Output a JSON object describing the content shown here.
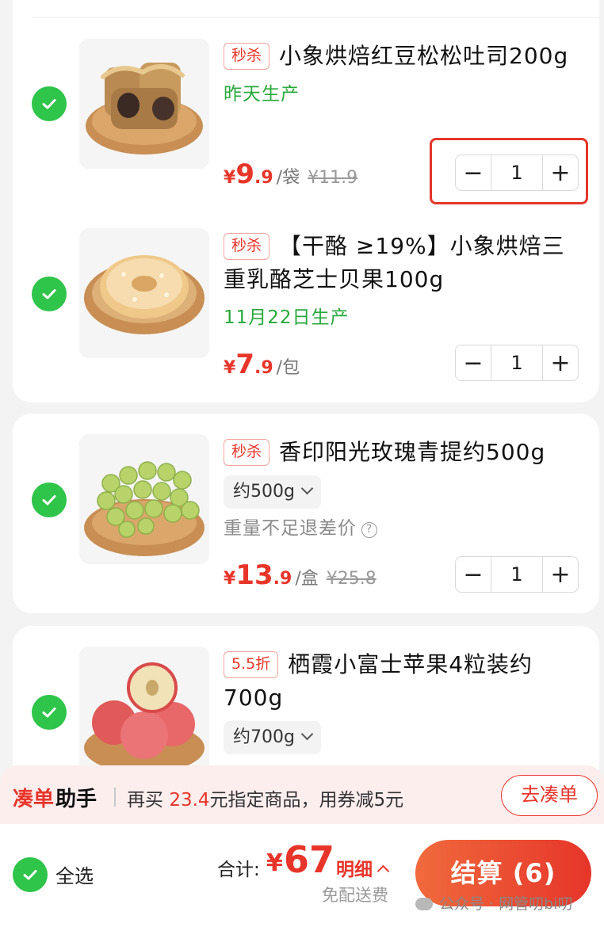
{
  "items": [
    {
      "tag": "秒杀",
      "title": "小象烘焙红豆松松吐司200g",
      "date": "昨天生产",
      "currency": "¥",
      "price_int": "9",
      "price_dec": ".9",
      "unit": "/袋",
      "old_price": "¥11.9",
      "qty": "1"
    },
    {
      "tag": "秒杀",
      "title": "【干酪 ≥19%】小象烘焙三重乳酪芝士贝果100g",
      "date": "11月22日生产",
      "currency": "¥",
      "price_int": "7",
      "price_dec": ".9",
      "unit": "/包",
      "qty": "1"
    },
    {
      "tag": "秒杀",
      "title": "香印阳光玫瑰青提约500g",
      "spec": "约500g",
      "note": "重量不足退差价",
      "note_icon": "?",
      "currency": "¥",
      "price_int": "13",
      "price_dec": ".9",
      "unit": "/盒",
      "old_price": "¥25.8",
      "qty": "1"
    },
    {
      "tag": "5.5折",
      "title": "栖霞小富士苹果4粒装约700g",
      "spec": "约700g"
    }
  ],
  "helper": {
    "name_a": "凑单",
    "name_b": "助手",
    "msg_pre": "再买",
    "msg_amount": "23.4",
    "msg_post": "元指定商品，用券减5元",
    "button": "去凑单"
  },
  "footer": {
    "select_all": "全选",
    "total_label": "合计:",
    "total_currency": "¥",
    "total_value": "67",
    "detail": "明细",
    "free_shipping": "免配送费",
    "checkout": "结算 (6)",
    "watermark": "公众号 · 网管叨bi叨"
  },
  "colors": {
    "accent": "#e8352a",
    "check": "#2fc44a",
    "fresh": "#29a93c"
  }
}
